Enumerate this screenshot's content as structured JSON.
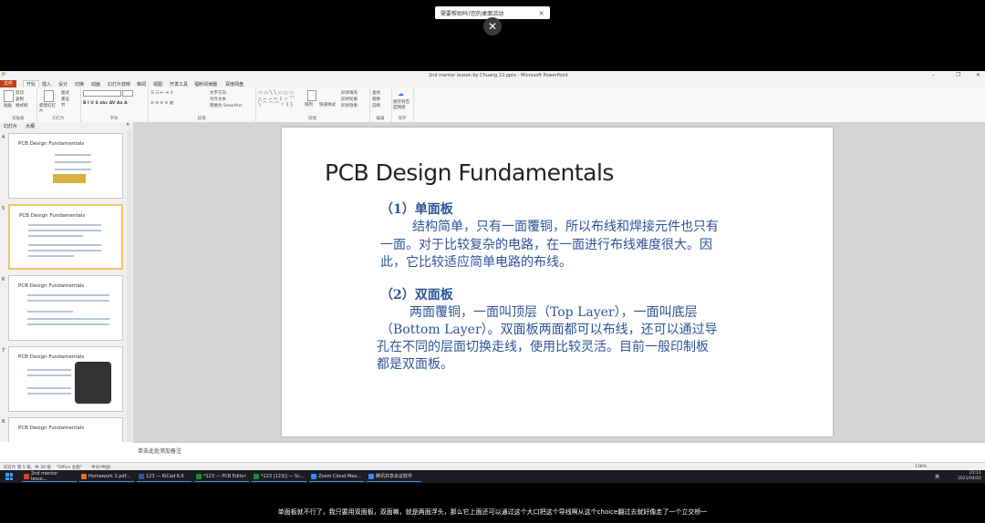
{
  "zoom_overlay": {
    "prompt": "需要帮助吗?您的桌面活动",
    "close_glyph": "×"
  },
  "window": {
    "title": "2nd mentor lesson by Chuang 22.pptx - Microsoft PowerPoint",
    "quick_access": "P"
  },
  "ribbon": {
    "tabs": [
      "文件",
      "开始",
      "插入",
      "设计",
      "切换",
      "动画",
      "幻灯片放映",
      "审阅",
      "视图",
      "开发工具",
      "福昕阅读器",
      "百度网盘"
    ],
    "groups": [
      "剪贴板",
      "幻灯片",
      "字体",
      "段落",
      "绘图",
      "编辑",
      "保存"
    ],
    "buttons": {
      "paste": "粘贴",
      "cut": "剪切",
      "copy": "复制",
      "format_painter": "格式刷",
      "new_slide": "新建幻灯片",
      "layout": "版式",
      "reset": "重设",
      "section": "节",
      "text_direction": "文字方向",
      "align_text": "对齐文本",
      "smartart": "转换为 SmartArt",
      "arrange": "排列",
      "quick_styles": "快速样式",
      "shape_fill": "形状填充",
      "shape_outline": "形状轮廓",
      "shape_effects": "形状效果",
      "find": "查找",
      "replace": "替换",
      "select": "选择",
      "save_to_baidu": "保存到百度网盘"
    }
  },
  "outline_pane": {
    "tabs": [
      "幻灯片",
      "大纲"
    ],
    "close_glyph": "×",
    "thumbnails": [
      {
        "num": "4",
        "title": "PCB Design Fundamentals",
        "selected": false
      },
      {
        "num": "5",
        "title": "PCB Design Fundamentals",
        "selected": true
      },
      {
        "num": "6",
        "title": "PCB Design Fundamentals",
        "selected": false
      },
      {
        "num": "7",
        "title": "PCB Design Fundamentals",
        "selected": false
      },
      {
        "num": "8",
        "title": "PCB Design Fundamentals",
        "selected": false
      }
    ]
  },
  "slide": {
    "title": "PCB Design Fundamentals",
    "section1_head": "（1）单面板",
    "section1_line1": "结构简单，只有一面覆铜，所以布线和焊接元件也只有",
    "section1_line2": "一面。对于比较复杂的电路，在一面进行布线难度很大。因",
    "section1_line3": "此，它比较适应简单电路的布线。",
    "section2_head": "（2）双面板",
    "section2_line1": "两面覆铜，一面叫顶层（Top Layer），一面叫底层",
    "section2_line2": "（Bottom Layer）。双面板两面都可以布线，还可以通过导",
    "section2_line3": "孔在不同的层面切换走线，使用比较灵活。目前一般印制板",
    "section2_line4": "都是双面板。"
  },
  "notes": {
    "placeholder": "单击此处添加备注"
  },
  "status_bar": {
    "slide_info": "幻灯片 第 5 张，共 30 张",
    "theme": "\"Office 主题\"",
    "language": "中文(中国)",
    "zoom": "128%"
  },
  "taskbar": {
    "items": [
      {
        "label": "2nd mentor lesso...",
        "color": "#d24726"
      },
      {
        "label": "Homework 2.pdf...",
        "color": "#e8701a"
      },
      {
        "label": "123 — KiCad 6.0",
        "color": "#2c5aa0"
      },
      {
        "label": "*123 — PCB Editor",
        "color": "#1f8a3a"
      },
      {
        "label": "*123 [123/] — Sc...",
        "color": "#1f8a3a"
      },
      {
        "label": "Zoom Cloud Mee...",
        "color": "#2d8cff"
      },
      {
        "label": "腾讯共享会议软件",
        "color": "#2d8cff"
      }
    ],
    "tray_lang": "英",
    "time": "21:11",
    "date": "2021/04/02"
  },
  "subtitle": "单面板就不行了，我只要用双面板，双面嘛，就是两面浮头，那么它上面还可以通过这个大口把这个导线啊从这个choice翻过去就好像走了一个立交桥一"
}
